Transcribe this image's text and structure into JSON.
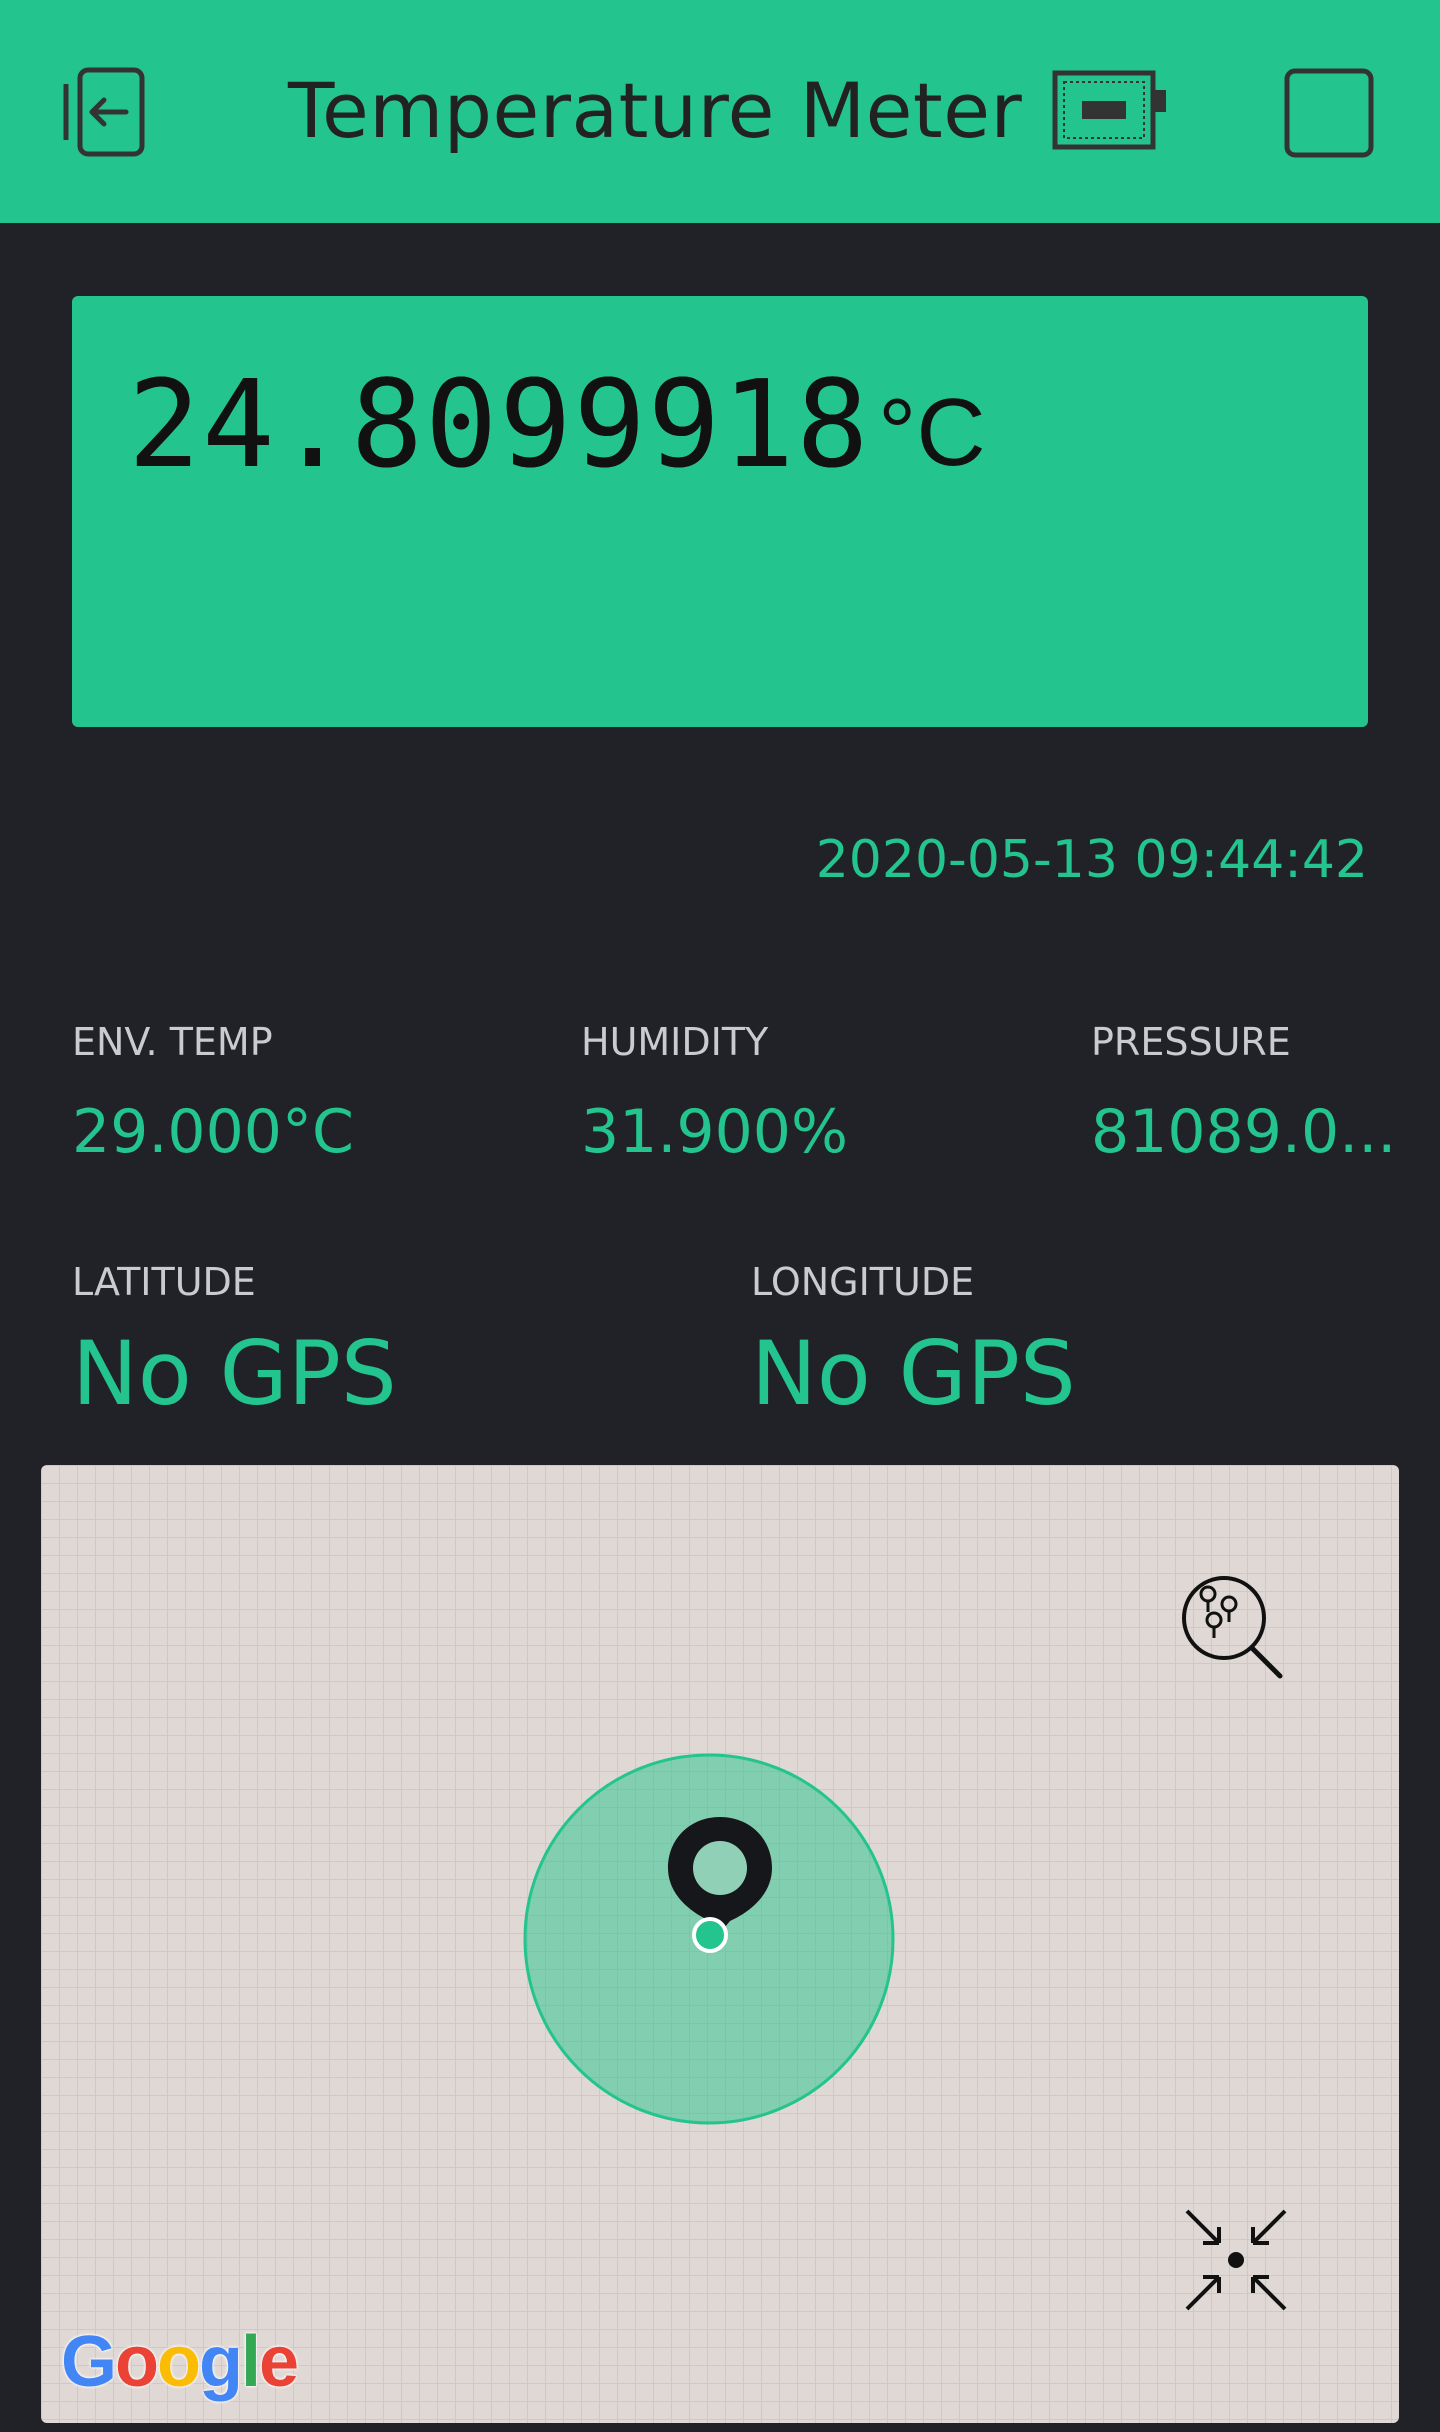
{
  "header": {
    "title": "Temperature Meter",
    "icons": [
      "back-icon",
      "device-icon",
      "square-icon"
    ],
    "bg_color": "#23c48e"
  },
  "lcd": {
    "value": "24.8099918",
    "unit": "°C"
  },
  "timestamp": "2020-05-13 09:44:42",
  "sensors": {
    "env_temp": {
      "label": "ENV. TEMP",
      "value": "29.000°C"
    },
    "humidity": {
      "label": "HUMIDITY",
      "value": "31.900%"
    },
    "pressure": {
      "label": "PRESSURE",
      "value": "81089.0..."
    }
  },
  "gps": {
    "latitude": {
      "label": "LATITUDE",
      "value": "No GPS"
    },
    "longitude": {
      "label": "LONGITUDE",
      "value": "No GPS"
    }
  },
  "map": {
    "icons": [
      "find-markers-icon",
      "location-pin-icon",
      "collapse-icon"
    ],
    "google": {
      "G": "G",
      "o1": "o",
      "o2": "o",
      "g": "g",
      "l": "l",
      "e": "e"
    }
  },
  "colors": {
    "accent": "#23c48e",
    "background": "#212227",
    "label": "#c9cbd0"
  }
}
